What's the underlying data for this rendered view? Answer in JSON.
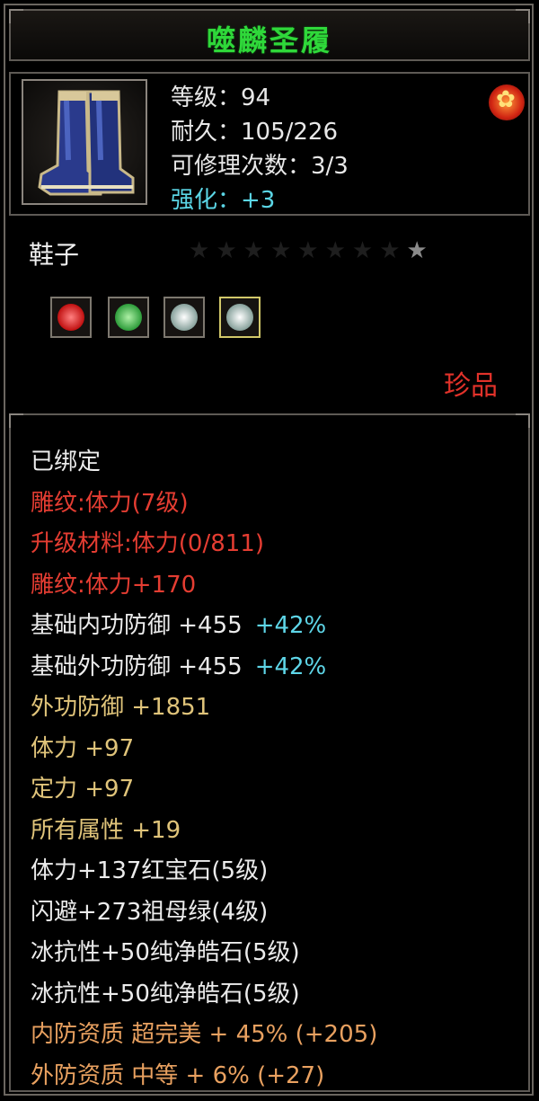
{
  "title": "噬麟圣履",
  "item": {
    "level": "等级：94",
    "durability": "耐久：105/226",
    "repair": "可修理次数：3/3",
    "enhance": "强化：+3",
    "type": "鞋子",
    "stars_lit": 1,
    "stars_total": 9,
    "rarity": "珍品"
  },
  "gems": [
    {
      "name": "ruby-icon",
      "color": "#d8201c"
    },
    {
      "name": "emerald-icon",
      "color": "#3fbf4a"
    },
    {
      "name": "diamond-icon",
      "color": "#cfe4e0"
    },
    {
      "name": "diamond-icon",
      "color": "#cfe4e0"
    }
  ],
  "attributes": [
    {
      "text": "已绑定",
      "color": "white"
    },
    {
      "text": "雕纹:体力(7级)",
      "color": "red"
    },
    {
      "text": "升级材料:体力(0/811)",
      "color": "red"
    },
    {
      "text": "雕纹:体力+170",
      "color": "red"
    },
    {
      "text": "基础内功防御 +455",
      "extra": "+42%",
      "color": "white"
    },
    {
      "text": "基础外功防御 +455",
      "extra": "+42%",
      "color": "white"
    },
    {
      "text": "外功防御 +1851",
      "color": "yellow"
    },
    {
      "text": "体力 +97",
      "color": "yellow"
    },
    {
      "text": "定力 +97",
      "color": "yellow"
    },
    {
      "text": "所有属性 +19",
      "color": "yellow"
    },
    {
      "text": "体力+137红宝石(5级)",
      "color": "white"
    },
    {
      "text": "闪避+273祖母绿(4级)",
      "color": "white"
    },
    {
      "text": "冰抗性+50纯净皓石(5级)",
      "color": "white"
    },
    {
      "text": "冰抗性+50纯净皓石(5级)",
      "color": "white"
    },
    {
      "text": "内防资质 超完美 + 45% (+205)",
      "color": "orange"
    },
    {
      "text": "外防资质 中等 + 6% (+27)",
      "color": "orange"
    }
  ]
}
